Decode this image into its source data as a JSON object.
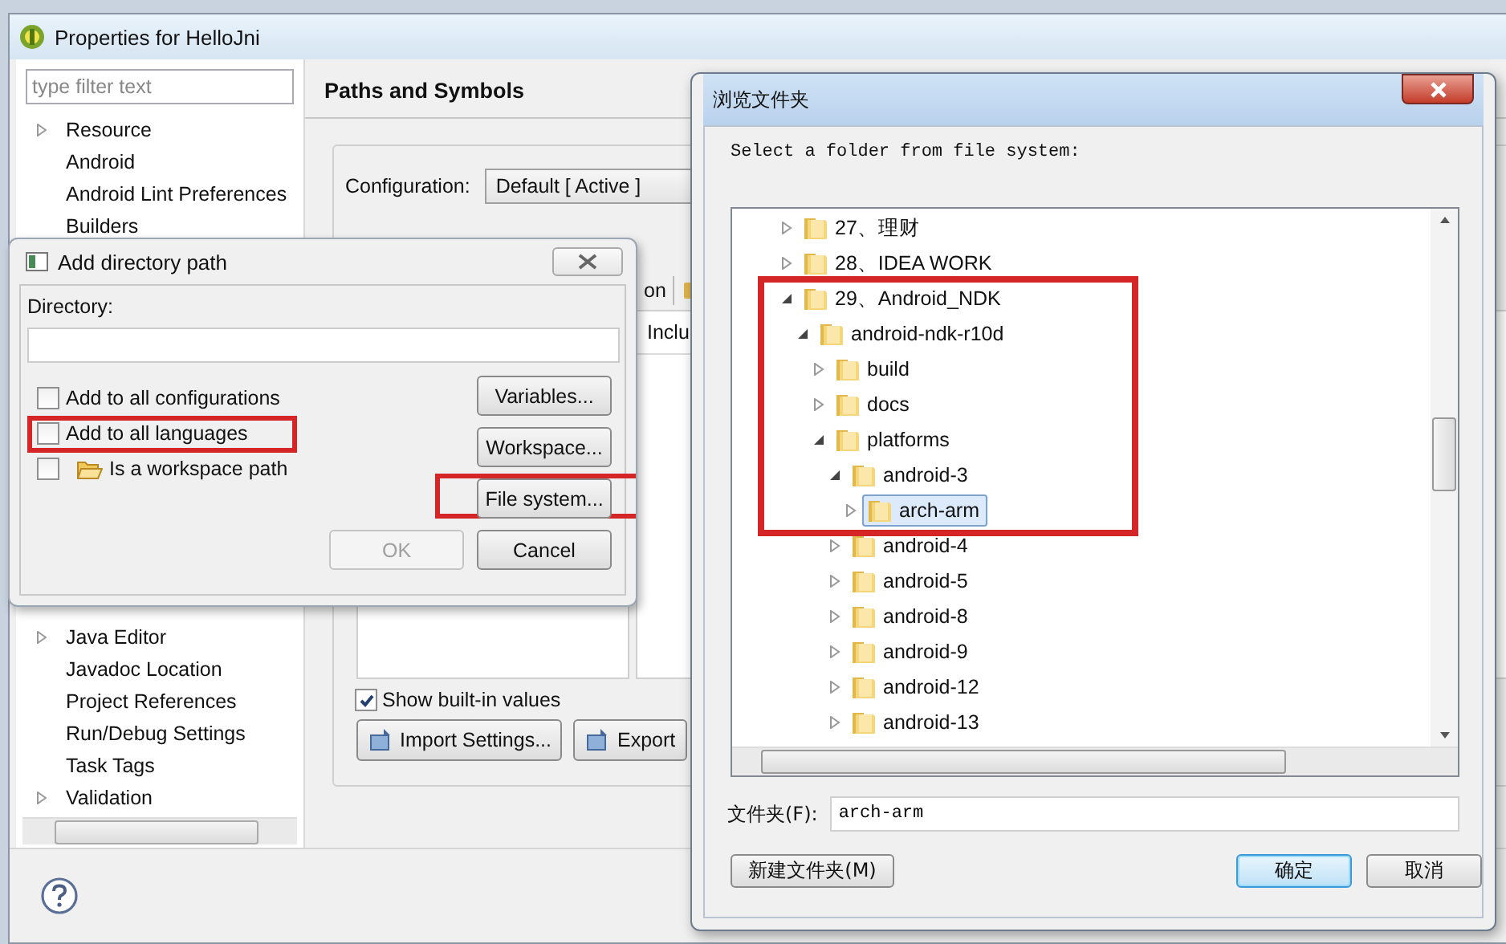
{
  "properties": {
    "title": "Properties for HelloJni",
    "filter_placeholder": "type filter text",
    "nav": [
      {
        "label": "Resource",
        "kind": "branch"
      },
      {
        "label": "Android",
        "kind": "leaf"
      },
      {
        "label": "Android Lint Preferences",
        "kind": "leaf"
      },
      {
        "label": "Builders",
        "kind": "leaf"
      }
    ],
    "nav_below_dialog": [
      {
        "label": "Java Editor",
        "kind": "branch"
      },
      {
        "label": "Javadoc Location",
        "kind": "leaf"
      },
      {
        "label": "Project References",
        "kind": "leaf"
      },
      {
        "label": "Run/Debug Settings",
        "kind": "leaf"
      },
      {
        "label": "Task Tags",
        "kind": "leaf"
      },
      {
        "label": "Validation",
        "kind": "branch"
      }
    ],
    "page_title": "Paths and Symbols",
    "configuration_label": "Configuration:",
    "configuration_value": "Default  [ Active ]",
    "tab_fragment": "on",
    "column_heading": "Inclu",
    "show_builtin": {
      "label": "Show built-in values",
      "checked": true
    },
    "buttons": [
      "Import Settings...",
      "Export"
    ]
  },
  "add_dialog": {
    "title": "Add directory path",
    "directory_label": "Directory:",
    "options": [
      {
        "label": "Add to all configurations",
        "checked": false,
        "highlighted": false,
        "kind": "plain"
      },
      {
        "label": "Add to all languages",
        "checked": false,
        "highlighted": true,
        "kind": "plain"
      },
      {
        "label": "Is a workspace path",
        "checked": false,
        "highlighted": false,
        "kind": "folder"
      }
    ],
    "side_buttons": [
      {
        "label": "Variables...",
        "highlighted": false
      },
      {
        "label": "Workspace...",
        "highlighted": false
      },
      {
        "label": "File system...",
        "highlighted": true
      }
    ],
    "ok": {
      "label": "OK",
      "disabled": true
    },
    "cancel": {
      "label": "Cancel",
      "disabled": false
    }
  },
  "browse_dialog": {
    "title": "浏览文件夹",
    "prompt": "Select a folder from file system:",
    "tree": [
      {
        "label": "27、理财",
        "expanded": false,
        "selected": false,
        "highlighted": false
      },
      {
        "label": "28、IDEA WORK",
        "expanded": false,
        "selected": false,
        "highlighted": false
      },
      {
        "label": "29、Android_NDK",
        "expanded": true,
        "selected": false,
        "highlighted": true,
        "children": [
          {
            "label": "android-ndk-r10d",
            "expanded": true,
            "selected": false,
            "highlighted": true,
            "children": [
              {
                "label": "build",
                "expanded": false,
                "selected": false,
                "highlighted": true
              },
              {
                "label": "docs",
                "expanded": false,
                "selected": false,
                "highlighted": true
              },
              {
                "label": "platforms",
                "expanded": true,
                "selected": false,
                "highlighted": true,
                "children": [
                  {
                    "label": "android-3",
                    "expanded": true,
                    "selected": false,
                    "highlighted": true,
                    "children": [
                      {
                        "label": "arch-arm",
                        "expanded": false,
                        "selected": true,
                        "highlighted": true
                      }
                    ]
                  },
                  {
                    "label": "android-4",
                    "expanded": false,
                    "selected": false,
                    "highlighted": false
                  },
                  {
                    "label": "android-5",
                    "expanded": false,
                    "selected": false,
                    "highlighted": false
                  },
                  {
                    "label": "android-8",
                    "expanded": false,
                    "selected": false,
                    "highlighted": false
                  },
                  {
                    "label": "android-9",
                    "expanded": false,
                    "selected": false,
                    "highlighted": false
                  },
                  {
                    "label": "android-12",
                    "expanded": false,
                    "selected": false,
                    "highlighted": false
                  },
                  {
                    "label": "android-13",
                    "expanded": false,
                    "selected": false,
                    "highlighted": false
                  }
                ]
              }
            ]
          }
        ]
      }
    ],
    "folder_label": "文件夹(F):",
    "folder_value": "arch-arm",
    "buttons": [
      {
        "label": "新建文件夹(M)",
        "default": false
      },
      {
        "label": "确定",
        "default": true
      },
      {
        "label": "取消",
        "default": false
      }
    ]
  }
}
